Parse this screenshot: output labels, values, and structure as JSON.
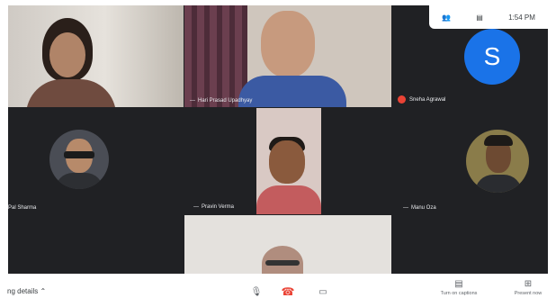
{
  "status": {
    "time": "1:54 PM",
    "people_icon": "people-icon",
    "chat_icon": "chat-icon"
  },
  "tiles": {
    "t2_name": "Hari Prasad Upadhyay",
    "t3_initial": "S",
    "t3_name": "Sneha Agrawal",
    "t4_name": "Pal Sharma",
    "t5_name": "Pravin Verma",
    "t6_name": "Manu Oza"
  },
  "bottom": {
    "meeting_details": "ng details",
    "captions_label": "Turn on captions",
    "present_label": "Present now"
  },
  "colors": {
    "avatar_bg": "#1a73e8",
    "end_call": "#ea4335",
    "stage_bg": "#202124"
  }
}
